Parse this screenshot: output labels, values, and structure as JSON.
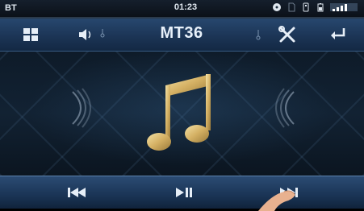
{
  "status_bar": {
    "bluetooth_label": "BT",
    "time": "01:23",
    "icons": [
      "disc-icon",
      "sd-card-icon",
      "usb-icon",
      "battery-icon",
      "signal-icon"
    ]
  },
  "toolbar": {
    "title": "MT36",
    "left_icons": [
      "grid-menu-icon",
      "volume-icon"
    ],
    "right_icons": [
      "tools-icon",
      "back-icon"
    ]
  },
  "playback": {
    "controls": [
      "previous-icon",
      "play-pause-icon",
      "next-icon"
    ]
  },
  "colors": {
    "toolbar_blue": "#1c3556",
    "note_gold": "#d9b96a",
    "text": "#e6eef7"
  }
}
